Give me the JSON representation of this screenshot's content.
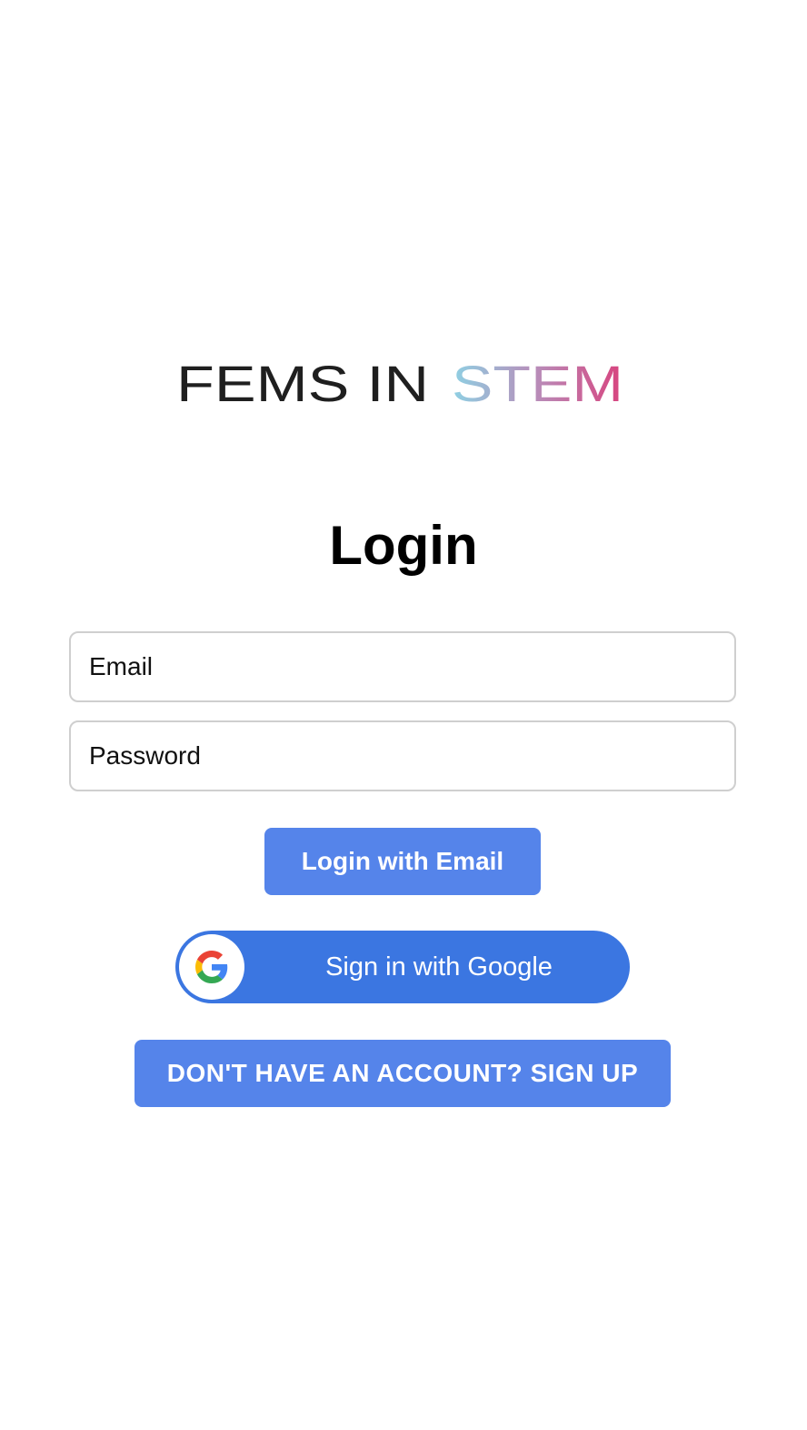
{
  "brand": {
    "logo_part1": "FEMS IN",
    "logo_part2": "STEM",
    "logo_dark_color": "#1f1f1f",
    "logo_gradient": [
      "#8fd0e3",
      "#b98bb8",
      "#d8437e"
    ]
  },
  "page": {
    "title": "Login"
  },
  "form": {
    "email_placeholder": "Email",
    "password_placeholder": "Password"
  },
  "buttons": {
    "login_email": "Login with Email",
    "google": "Sign in with Google",
    "signup": "DON'T HAVE AN ACCOUNT? SIGN UP"
  },
  "colors": {
    "primary": "#5584ea",
    "google_blue": "#3b76e1",
    "input_border": "#cfcfcf"
  },
  "icons": {
    "google": "google-g-icon"
  }
}
